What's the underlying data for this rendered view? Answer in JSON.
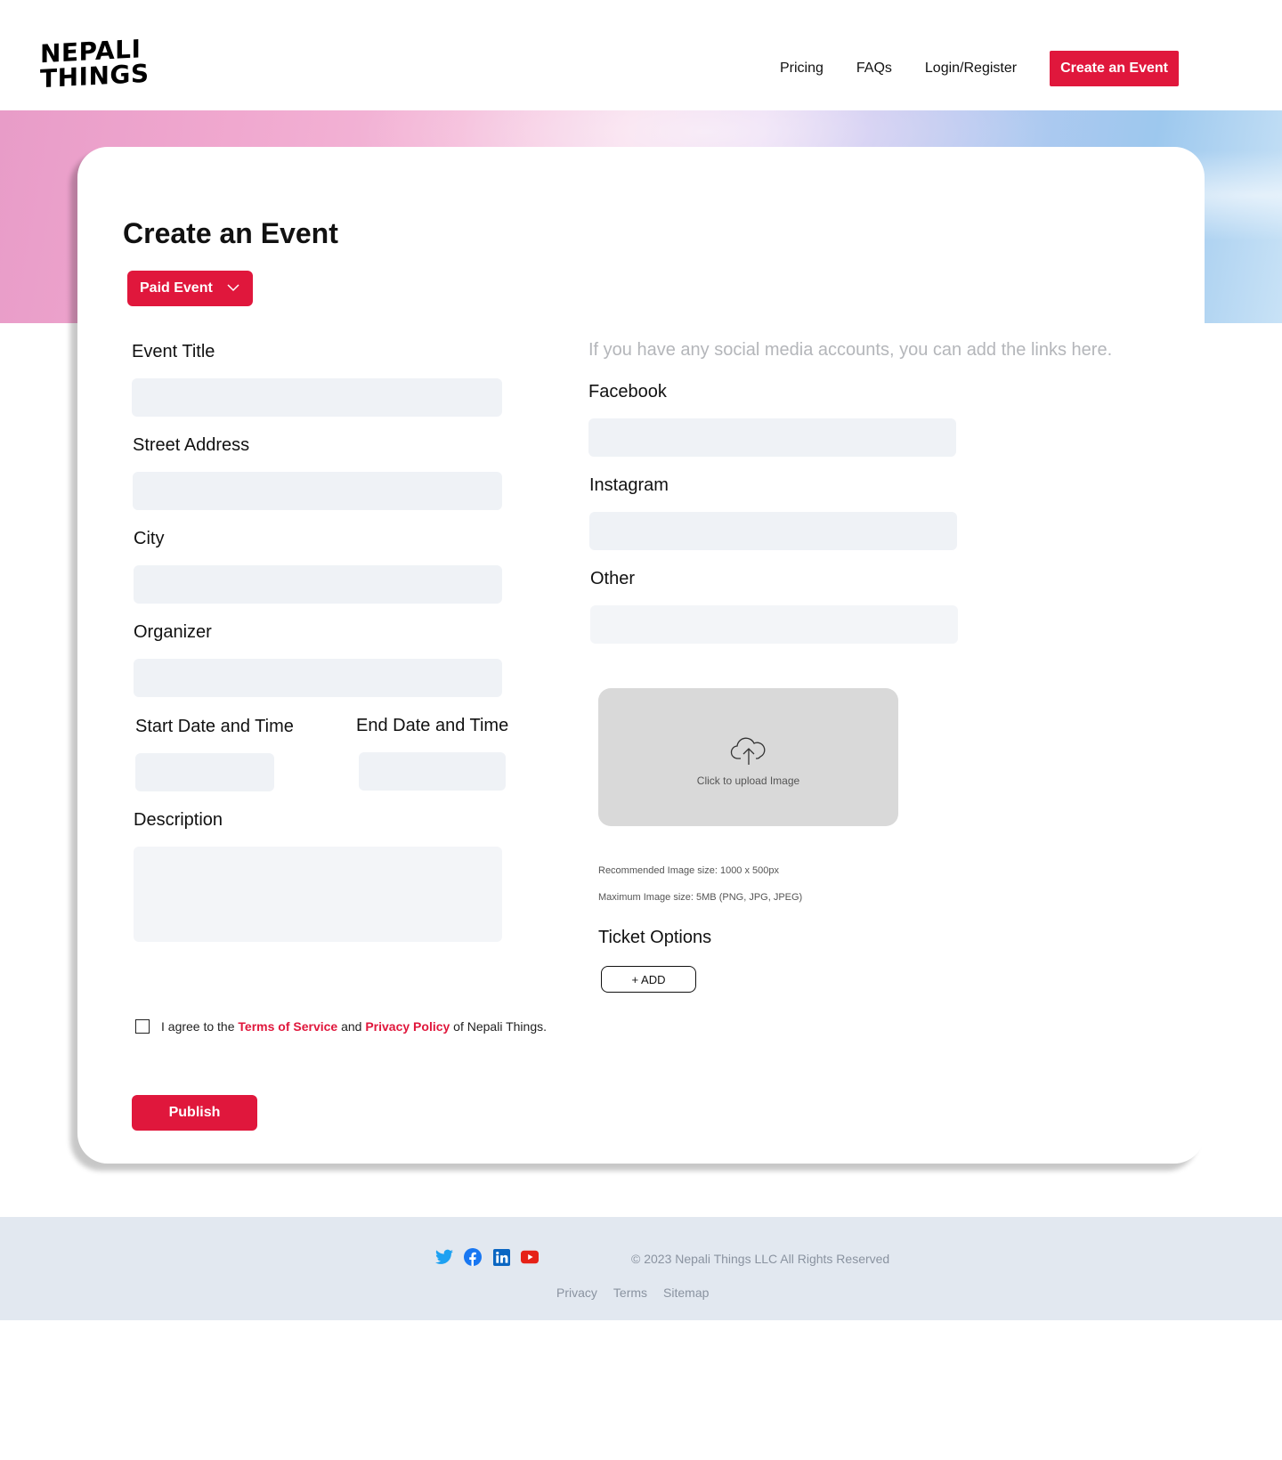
{
  "brand": {
    "line1": "NEPALI",
    "line2": "THINGS"
  },
  "nav": {
    "pricing": "Pricing",
    "faqs": "FAQs",
    "login": "Login/Register",
    "create": "Create an Event"
  },
  "form": {
    "title": "Create an Event",
    "event_type": "Paid Event",
    "event_title_label": "Event Title",
    "street_label": "Street Address",
    "city_label": "City",
    "organizer_label": "Organizer",
    "start_label": "Start Date and Time",
    "end_label": "End Date and Time",
    "description_label": "Description",
    "social_hint": "If you have any social media accounts, you can add the links here.",
    "facebook_label": "Facebook",
    "instagram_label": "Instagram",
    "other_label": "Other",
    "upload_text": "Click to upload Image",
    "recommended_note": "Recommended Image size: 1000 x 500px",
    "max_note": "Maximum Image size: 5MB (PNG, JPG, JPEG)",
    "ticket_title": "Ticket Options",
    "add_label": "+ ADD",
    "agree_pre": "I agree to the ",
    "terms": "Terms of Service",
    "agree_mid": " and ",
    "privacy": "Privacy Policy",
    "agree_post": " of Nepali Things.",
    "publish": "Publish"
  },
  "footer": {
    "copyright": "© 2023 Nepali  Things LLC All Rights Reserved",
    "links": [
      "Privacy",
      "Terms",
      "Sitemap"
    ],
    "socials": [
      "twitter-icon",
      "facebook-icon",
      "linkedin-icon",
      "youtube-icon"
    ]
  },
  "colors": {
    "accent": "#e0173c",
    "input_bg": "#eff2f6",
    "footer_bg": "#e2e8f0"
  }
}
